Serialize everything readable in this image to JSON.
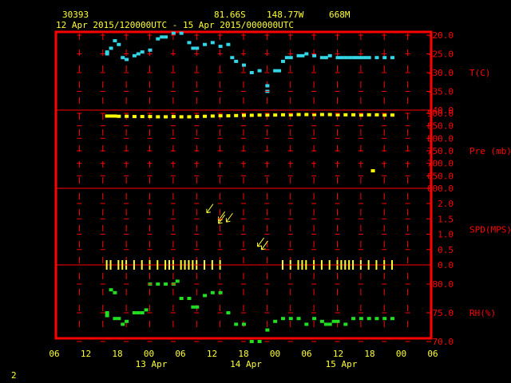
{
  "header": {
    "station_id": "30393",
    "lat": "81.66S",
    "lon": "148.77W",
    "elevation": "668M",
    "period": "12 Apr 2015/120000UTC - 15 Apr 2015/000000UTC"
  },
  "footer": {
    "page_number": "2"
  },
  "colors": {
    "frame": "#ff0000",
    "text": "#ffff33",
    "temp": "#33d6e6",
    "pressure": "#ffff00",
    "wind": "#ffff33",
    "rh": "#22dd22"
  },
  "chart_data": [
    {
      "type": "scatter",
      "panel": "temperature",
      "ylabel": "T(C)",
      "ylim": [
        -40,
        -20
      ],
      "yticks": [
        "-20.0",
        "-25.0",
        "-30.0",
        "-35.0",
        "-40.0"
      ],
      "x_unit": "hours since 12 Apr 2015 06 UTC",
      "points": [
        [
          13,
          -24.5
        ],
        [
          13,
          -25.0
        ],
        [
          14,
          -23.5
        ],
        [
          15,
          -21.5
        ],
        [
          16,
          -22.5
        ],
        [
          17,
          -26.0
        ],
        [
          18,
          -26.5
        ],
        [
          20,
          -25.5
        ],
        [
          21,
          -25.0
        ],
        [
          22,
          -24.5
        ],
        [
          24,
          -24.0
        ],
        [
          26,
          -21.0
        ],
        [
          27,
          -20.5
        ],
        [
          28,
          -20.5
        ],
        [
          30,
          -19.5
        ],
        [
          32,
          -19.5
        ],
        [
          34,
          -22.0
        ],
        [
          35,
          -23.5
        ],
        [
          36,
          -23.5
        ],
        [
          38,
          -22.5
        ],
        [
          40,
          -22.0
        ],
        [
          42,
          -23.0
        ],
        [
          44,
          -22.5
        ],
        [
          45,
          -26.0
        ],
        [
          46,
          -27.0
        ],
        [
          48,
          -28.0
        ],
        [
          50,
          -30.0
        ],
        [
          52,
          -29.5
        ],
        [
          54,
          -33.5
        ],
        [
          54,
          -35.0
        ],
        [
          56,
          -29.5
        ],
        [
          57,
          -29.5
        ],
        [
          58,
          -27.0
        ],
        [
          59,
          -26.0
        ],
        [
          60,
          -26.0
        ],
        [
          62,
          -25.5
        ],
        [
          63,
          -25.5
        ],
        [
          64,
          -25.0
        ],
        [
          66,
          -25.5
        ],
        [
          68,
          -26.0
        ],
        [
          69,
          -26.0
        ],
        [
          70,
          -25.5
        ],
        [
          72,
          -26.0
        ],
        [
          73,
          -26.0
        ],
        [
          74,
          -26.0
        ],
        [
          75,
          -26.0
        ],
        [
          76,
          -26.0
        ],
        [
          77,
          -26.0
        ],
        [
          78,
          -26.0
        ],
        [
          79,
          -26.0
        ],
        [
          80,
          -26.0
        ],
        [
          82,
          -26.0
        ],
        [
          84,
          -26.0
        ],
        [
          86,
          -26.0
        ]
      ]
    },
    {
      "type": "scatter",
      "panel": "pressure",
      "ylabel": "Pre (mb)",
      "ylim": [
        600,
        900
      ],
      "yticks": [
        "900.0",
        "850.0",
        "800.0",
        "750.0",
        "700.0",
        "650.0",
        "600.0"
      ],
      "points": [
        [
          13,
          889
        ],
        [
          14,
          889
        ],
        [
          15,
          889
        ],
        [
          16,
          888
        ],
        [
          18,
          888
        ],
        [
          20,
          887
        ],
        [
          22,
          887
        ],
        [
          24,
          887
        ],
        [
          26,
          886
        ],
        [
          28,
          886
        ],
        [
          30,
          887
        ],
        [
          32,
          886
        ],
        [
          34,
          886
        ],
        [
          36,
          887
        ],
        [
          38,
          888
        ],
        [
          40,
          889
        ],
        [
          42,
          890
        ],
        [
          44,
          890
        ],
        [
          46,
          891
        ],
        [
          48,
          892
        ],
        [
          50,
          892
        ],
        [
          52,
          893
        ],
        [
          54,
          893
        ],
        [
          56,
          893
        ],
        [
          58,
          894
        ],
        [
          60,
          894
        ],
        [
          62,
          895
        ],
        [
          64,
          895
        ],
        [
          66,
          895
        ],
        [
          68,
          895
        ],
        [
          70,
          895
        ],
        [
          72,
          894
        ],
        [
          74,
          894
        ],
        [
          76,
          894
        ],
        [
          78,
          893
        ],
        [
          80,
          894
        ],
        [
          82,
          894
        ],
        [
          84,
          893
        ],
        [
          86,
          893
        ],
        [
          81,
          670
        ]
      ]
    },
    {
      "type": "scatter",
      "panel": "wind",
      "ylabel": "SPD(MPS)",
      "ylim": [
        0,
        2
      ],
      "yticks": [
        "2.0",
        "1.5",
        "1.0",
        "0.5",
        "0.0"
      ],
      "calm_hours": [
        13,
        14,
        16,
        17,
        18,
        20,
        22,
        24,
        26,
        28,
        29,
        30,
        32,
        33,
        34,
        35,
        36,
        38,
        40,
        42,
        58,
        60,
        62,
        63,
        64,
        66,
        68,
        70,
        72,
        73,
        74,
        75,
        76,
        78,
        80,
        82,
        84,
        86
      ],
      "arrows": [
        [
          39,
          1.8
        ],
        [
          42,
          1.55
        ],
        [
          42,
          1.45
        ],
        [
          44,
          1.5
        ],
        [
          52,
          0.7
        ],
        [
          53,
          0.6
        ]
      ]
    },
    {
      "type": "scatter",
      "panel": "relative humidity",
      "ylabel": "RH(%)",
      "ylim": [
        70,
        80
      ],
      "yticks": [
        "80.0",
        "75.0",
        "70.0"
      ],
      "points": [
        [
          13,
          75.0
        ],
        [
          13,
          74.5
        ],
        [
          14,
          79.0
        ],
        [
          15,
          78.5
        ],
        [
          15,
          74.0
        ],
        [
          16,
          74.0
        ],
        [
          17,
          73.0
        ],
        [
          18,
          73.5
        ],
        [
          20,
          75.0
        ],
        [
          21,
          75.0
        ],
        [
          22,
          75.0
        ],
        [
          23,
          75.5
        ],
        [
          24,
          80.0
        ],
        [
          26,
          80.0
        ],
        [
          28,
          80.0
        ],
        [
          30,
          80.0
        ],
        [
          31,
          80.5
        ],
        [
          32,
          77.5
        ],
        [
          34,
          77.5
        ],
        [
          35,
          76.0
        ],
        [
          36,
          76.0
        ],
        [
          38,
          78.0
        ],
        [
          40,
          78.5
        ],
        [
          42,
          78.5
        ],
        [
          44,
          75.0
        ],
        [
          46,
          73.0
        ],
        [
          48,
          73.0
        ],
        [
          50,
          70.0
        ],
        [
          52,
          70.0
        ],
        [
          54,
          72.0
        ],
        [
          56,
          73.5
        ],
        [
          58,
          74.0
        ],
        [
          60,
          74.0
        ],
        [
          62,
          74.0
        ],
        [
          64,
          73.0
        ],
        [
          66,
          74.0
        ],
        [
          68,
          73.5
        ],
        [
          69,
          73.0
        ],
        [
          70,
          73.0
        ],
        [
          71,
          73.5
        ],
        [
          72,
          73.5
        ],
        [
          74,
          73.0
        ],
        [
          76,
          74.0
        ],
        [
          78,
          74.0
        ],
        [
          80,
          74.0
        ],
        [
          82,
          74.0
        ],
        [
          84,
          74.0
        ],
        [
          86,
          74.0
        ]
      ]
    }
  ],
  "x_axis": {
    "tick_labels": [
      "06",
      "12",
      "18",
      "00",
      "06",
      "12",
      "18",
      "00",
      "06",
      "12",
      "18",
      "00",
      "06"
    ],
    "date_labels": [
      "13 Apr",
      "14 Apr",
      "15 Apr"
    ]
  }
}
